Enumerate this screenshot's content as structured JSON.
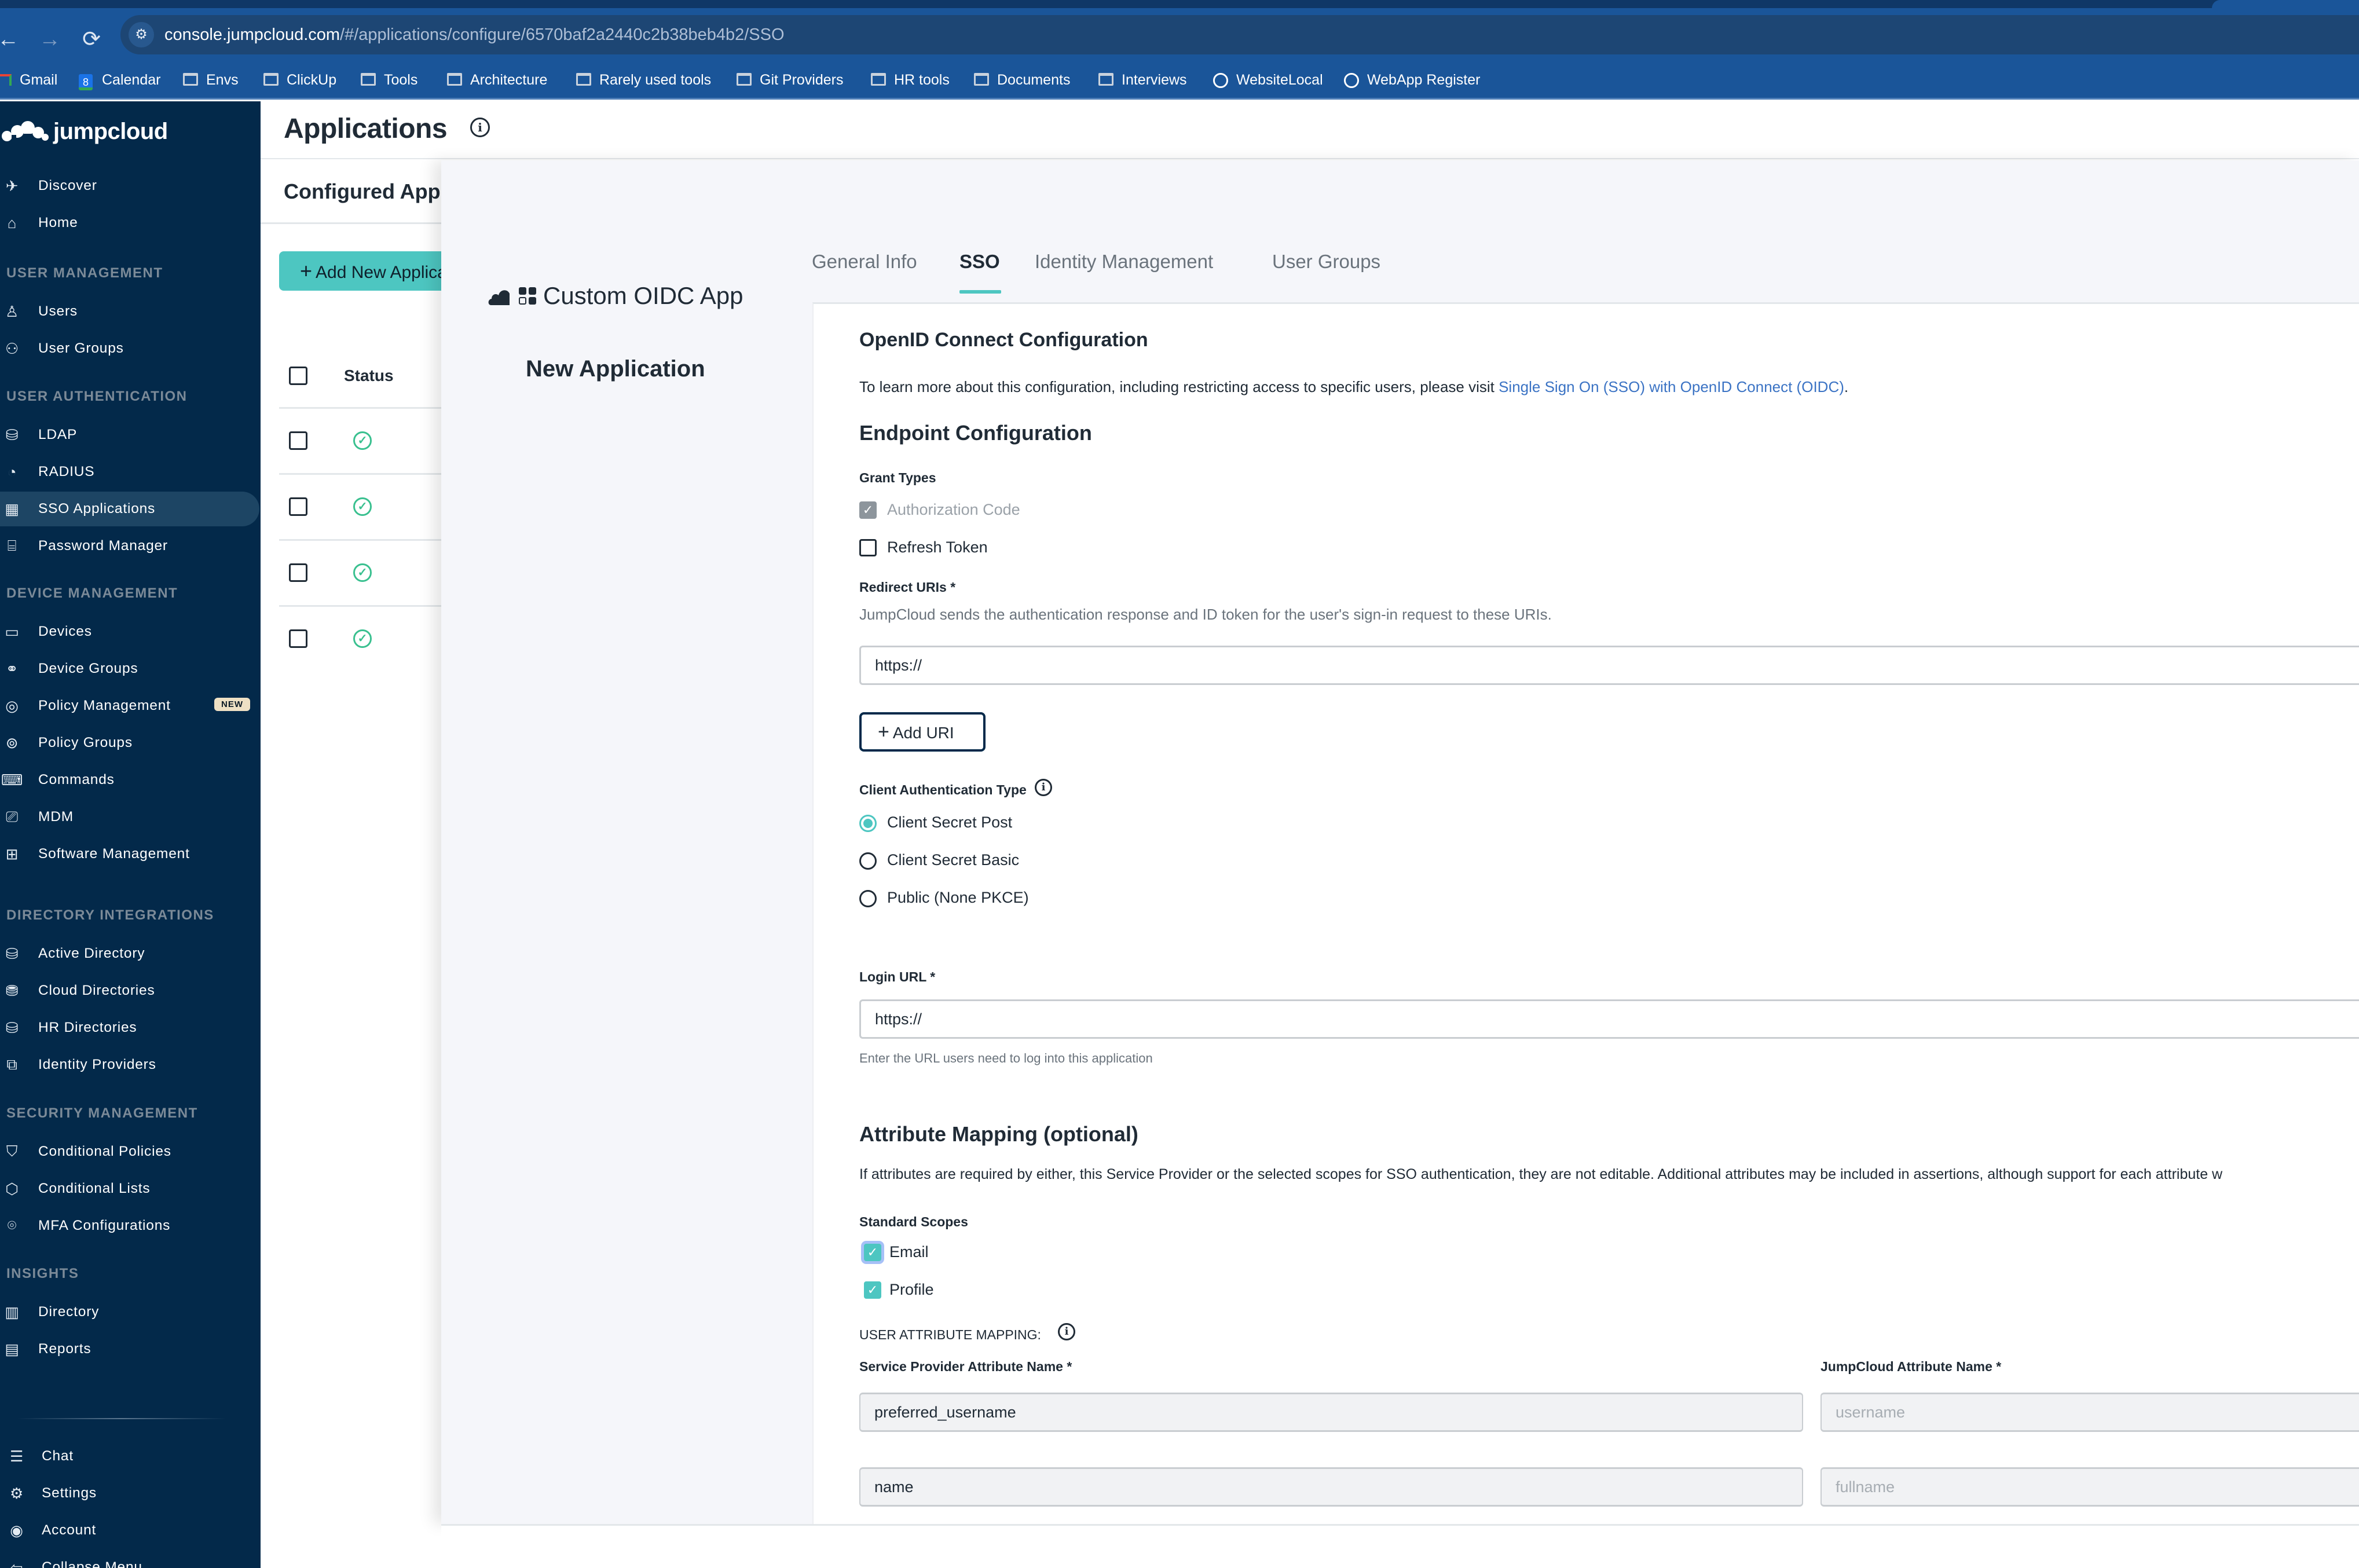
{
  "browser": {
    "url_host": "console.jumpcloud.com",
    "url_path": "/#/applications/configure/6570baf2a2440c2b38beb4b2/SSO",
    "nav": {
      "back_icon": "←",
      "forward_icon": "→",
      "reload_icon": "⟳",
      "site_settings_icon": "⚙"
    },
    "bookmarks": [
      {
        "label": "Gmail",
        "icon": "gmail-icon"
      },
      {
        "label": "Calendar",
        "icon": "calendar-icon",
        "glyph": "8"
      },
      {
        "label": "Envs",
        "icon": "folder-icon"
      },
      {
        "label": "ClickUp",
        "icon": "folder-icon"
      },
      {
        "label": "Tools",
        "icon": "folder-icon"
      },
      {
        "label": "Architecture",
        "icon": "folder-icon"
      },
      {
        "label": "Rarely used tools",
        "icon": "folder-icon"
      },
      {
        "label": "Git Providers",
        "icon": "folder-icon"
      },
      {
        "label": "HR tools",
        "icon": "folder-icon"
      },
      {
        "label": "Documents",
        "icon": "folder-icon"
      },
      {
        "label": "Interviews",
        "icon": "folder-icon"
      },
      {
        "label": "WebsiteLocal",
        "icon": "globe-icon"
      },
      {
        "label": "WebApp Register",
        "icon": "globe-icon"
      }
    ]
  },
  "sidebar": {
    "logo_text": "jumpcloud",
    "top_items": [
      {
        "label": "Discover",
        "icon": "rocket-icon",
        "glyph": "✈"
      },
      {
        "label": "Home",
        "icon": "home-icon",
        "glyph": "⌂"
      }
    ],
    "sections": [
      {
        "title": "USER MANAGEMENT",
        "items": [
          {
            "label": "Users",
            "icon": "user-icon",
            "glyph": "♙"
          },
          {
            "label": "User Groups",
            "icon": "user-groups-icon",
            "glyph": "⚇"
          }
        ]
      },
      {
        "title": "USER AUTHENTICATION",
        "items": [
          {
            "label": "LDAP",
            "icon": "ldap-icon",
            "glyph": "⛁"
          },
          {
            "label": "RADIUS",
            "icon": "radius-icon",
            "glyph": "◔"
          },
          {
            "label": "SSO Applications",
            "icon": "sso-apps-icon",
            "glyph": "▦",
            "active": true
          },
          {
            "label": "Password Manager",
            "icon": "password-manager-icon",
            "glyph": "⌸"
          }
        ]
      },
      {
        "title": "DEVICE MANAGEMENT",
        "items": [
          {
            "label": "Devices",
            "icon": "devices-icon",
            "glyph": "▭"
          },
          {
            "label": "Device Groups",
            "icon": "device-groups-icon",
            "glyph": "⚭"
          },
          {
            "label": "Policy Management",
            "icon": "policy-management-icon",
            "glyph": "◎",
            "badge": "NEW"
          },
          {
            "label": "Policy Groups",
            "icon": "policy-groups-icon",
            "glyph": "⊚"
          },
          {
            "label": "Commands",
            "icon": "commands-icon",
            "glyph": "⌨"
          },
          {
            "label": "MDM",
            "icon": "mdm-icon",
            "glyph": "⎚"
          },
          {
            "label": "Software Management",
            "icon": "software-management-icon",
            "glyph": "⊞"
          }
        ]
      },
      {
        "title": "DIRECTORY INTEGRATIONS",
        "items": [
          {
            "label": "Active Directory",
            "icon": "active-directory-icon",
            "glyph": "⛁"
          },
          {
            "label": "Cloud Directories",
            "icon": "cloud-directories-icon",
            "glyph": "⛃"
          },
          {
            "label": "HR Directories",
            "icon": "hr-directories-icon",
            "glyph": "⛁"
          },
          {
            "label": "Identity Providers",
            "icon": "identity-providers-icon",
            "glyph": "⧉"
          }
        ]
      },
      {
        "title": "SECURITY MANAGEMENT",
        "items": [
          {
            "label": "Conditional Policies",
            "icon": "shield-icon",
            "glyph": "⛉"
          },
          {
            "label": "Conditional Lists",
            "icon": "conditional-lists-icon",
            "glyph": "⬡"
          },
          {
            "label": "MFA Configurations",
            "icon": "mfa-icon",
            "glyph": "⌾"
          }
        ]
      },
      {
        "title": "INSIGHTS",
        "items": [
          {
            "label": "Directory",
            "icon": "chart-icon",
            "glyph": "▥"
          },
          {
            "label": "Reports",
            "icon": "reports-icon",
            "glyph": "▤"
          }
        ]
      }
    ],
    "bottom_items": [
      {
        "label": "Chat",
        "icon": "chat-icon",
        "glyph": "☰"
      },
      {
        "label": "Settings",
        "icon": "gear-icon",
        "glyph": "⚙"
      },
      {
        "label": "Account",
        "icon": "account-icon",
        "glyph": "◉"
      },
      {
        "label": "Collapse Menu",
        "icon": "collapse-icon",
        "glyph": "⇦"
      }
    ]
  },
  "page": {
    "title": "Applications",
    "info_glyph": "i",
    "configured_title": "Configured Applications",
    "add_button_label": "Add New Application",
    "add_button_plus": "+",
    "table": {
      "status_header": "Status",
      "rows": [
        {
          "status": "active",
          "glyph": "✓"
        },
        {
          "status": "active",
          "glyph": "✓"
        },
        {
          "status": "active",
          "glyph": "✓"
        },
        {
          "status": "active",
          "glyph": "✓"
        }
      ]
    }
  },
  "panel": {
    "app_name": "Custom OIDC App",
    "app_status": "New Application",
    "tabs": [
      {
        "label": "General Info",
        "active": false
      },
      {
        "label": "SSO",
        "active": true
      },
      {
        "label": "Identity Management",
        "active": false
      },
      {
        "label": "User Groups",
        "active": false
      }
    ],
    "oidc": {
      "heading": "OpenID Connect Configuration",
      "intro_text": "To learn more about this configuration, including restricting access to specific users, please visit ",
      "intro_link": "Single Sign On (SSO) with OpenID Connect (OIDC)",
      "intro_end": "."
    },
    "endpoint": {
      "heading": "Endpoint Configuration",
      "grant_types_label": "Grant Types",
      "grant_types": [
        {
          "label": "Authorization Code",
          "checked": true,
          "disabled": true
        },
        {
          "label": "Refresh Token",
          "checked": false,
          "disabled": false
        }
      ],
      "check_glyph": "✓",
      "redirect_label": "Redirect URIs *",
      "redirect_help": "JumpCloud sends the authentication response and ID token for the user's sign-in request to these URIs.",
      "redirect_value": "https://",
      "add_uri_label": "Add URI",
      "add_uri_plus": "+",
      "client_auth_label": "Client Authentication Type",
      "client_auth_options": [
        {
          "label": "Client Secret Post",
          "selected": true
        },
        {
          "label": "Client Secret Basic",
          "selected": false
        },
        {
          "label": "Public (None PKCE)",
          "selected": false
        }
      ],
      "login_url_label": "Login URL *",
      "login_url_value": "https://",
      "login_url_help": "Enter the URL users need to log into this application"
    },
    "attributes": {
      "heading": "Attribute Mapping (optional)",
      "description": "If attributes are required by either, this Service Provider or the selected scopes for SSO authentication, they are not editable. Additional attributes may be included in assertions, although support for each attribute w",
      "standard_scopes_label": "Standard Scopes",
      "scopes": [
        {
          "label": "Email",
          "checked": true,
          "focused": true
        },
        {
          "label": "Profile",
          "checked": true,
          "focused": false
        }
      ],
      "user_mapping_label": "USER ATTRIBUTE MAPPING:",
      "sp_attr_header": "Service Provider Attribute Name *",
      "jc_attr_header": "JumpCloud Attribute Name *",
      "mappings": [
        {
          "sp": "preferred_username",
          "jc_placeholder": "username"
        },
        {
          "sp": "name",
          "jc_placeholder": "fullname"
        }
      ]
    }
  },
  "colors": {
    "sidebar_bg": "#03294a",
    "accent_teal": "#4dc6c1",
    "link_blue": "#3b73c4",
    "status_green": "#39c08f",
    "browser_blue": "#1a5599"
  }
}
